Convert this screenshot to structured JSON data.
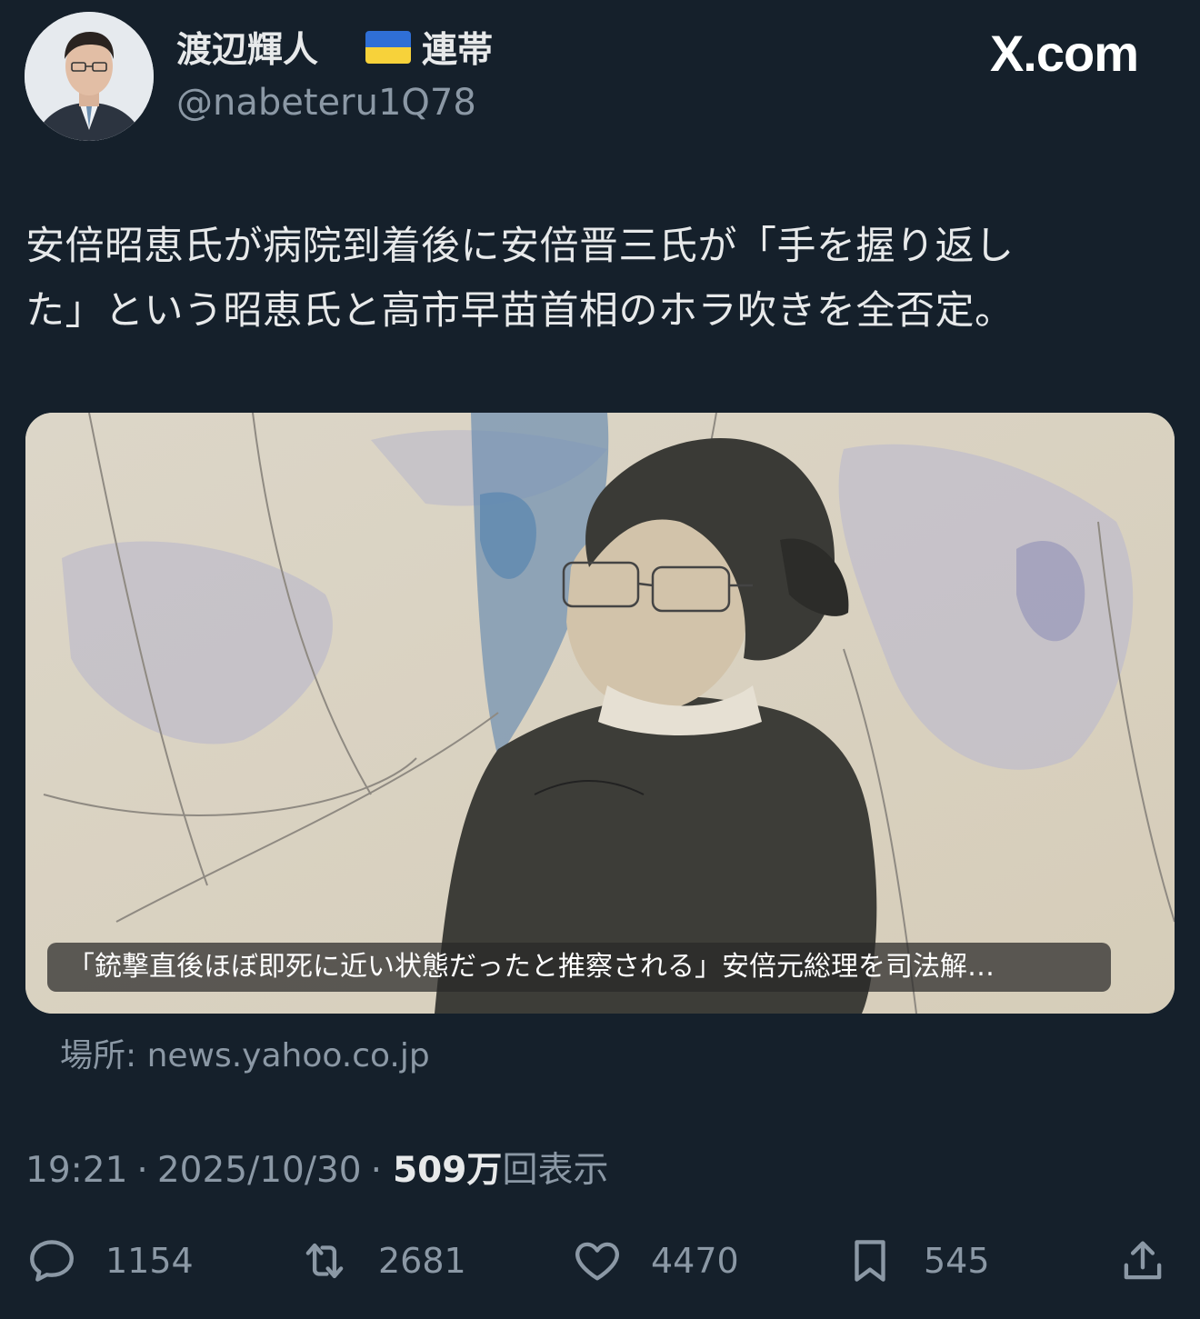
{
  "author": {
    "display_name": "渡辺輝人",
    "badge_label": "連帯",
    "flag_icon": "ukraine-flag-icon",
    "handle": "@nabeteru1Q78"
  },
  "brand": {
    "label": "X.com"
  },
  "tweet": {
    "lines": [
      "安倍昭恵氏が病院到着後に安倍晋三氏が「手を握り返し",
      "た」という昭恵氏と高市早苗首相のホラ吹きを全否定。"
    ]
  },
  "media": {
    "caption": "「銃撃直後ほぼ即死に近い状態だったと推察される」安倍元総理を司法解…",
    "source": "場所: news.yahoo.co.jp"
  },
  "meta": {
    "time": "19:21",
    "separator": "·",
    "date": "2025/10/30",
    "views": "509万",
    "views_label": "回表示"
  },
  "actions": {
    "replies": "1154",
    "reposts": "2681",
    "likes": "4470",
    "bookmarks": "545"
  },
  "colors": {
    "background": "#15202b",
    "text": "#e7e9ea",
    "muted": "#8b98a5"
  }
}
